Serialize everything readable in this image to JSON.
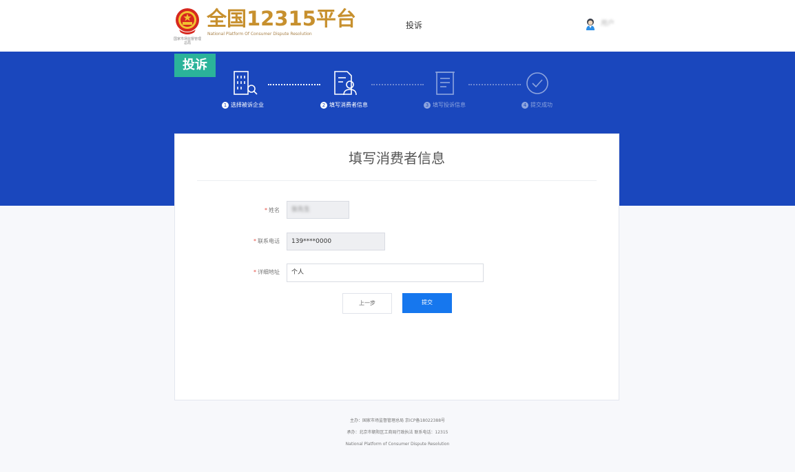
{
  "header": {
    "emblem_caption": "国家市场监督管理总局",
    "title": "全国12315平台",
    "subtitle": "National Platform Of Consumer Dispute Resolution",
    "nav_link": "投诉",
    "user_name": "用户"
  },
  "banner": {
    "tag": "投诉",
    "steps": [
      {
        "num": "1",
        "label": "选择被诉企业"
      },
      {
        "num": "2",
        "label": "填写消费者信息"
      },
      {
        "num": "3",
        "label": "填写投诉信息"
      },
      {
        "num": "4",
        "label": "提交成功"
      }
    ]
  },
  "form": {
    "title": "填写消费者信息",
    "required_mark": "*",
    "name_label": "姓名",
    "name_value": "张先生",
    "phone_label": "联系电话",
    "phone_value": "139****0000",
    "address_label": "详细地址",
    "address_value": "个人",
    "prev_button": "上一步",
    "submit_button": "提交"
  },
  "footer": {
    "line1": "主办：国家市场监督管理总局  京ICP备18022388号",
    "line2": "承办：北京市朝阳区工商局行政执法  联系电话：12315",
    "line3": "National Platform of Consumer Dispute Resolution"
  },
  "colors": {
    "banner": "#1a47bd",
    "tag": "#2bb39a",
    "logo": "#c7902e",
    "primary_button": "#1677ee"
  }
}
